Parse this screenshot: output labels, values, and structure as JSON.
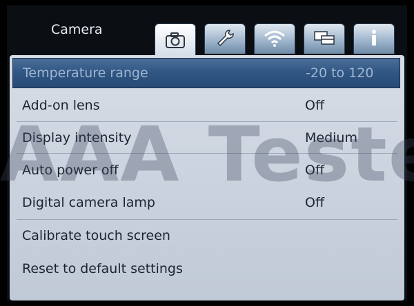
{
  "header": {
    "title": "Camera"
  },
  "tabs": [
    {
      "icon": "camera-icon",
      "active": true
    },
    {
      "icon": "wrench-icon",
      "active": false
    },
    {
      "icon": "wifi-icon",
      "active": false
    },
    {
      "icon": "devices-icon",
      "active": false
    },
    {
      "icon": "info-icon",
      "active": false
    }
  ],
  "settings": [
    {
      "label": "Temperature range",
      "value": "-20 to 120",
      "selected": true
    },
    {
      "label": "Add-on lens",
      "value": "Off"
    },
    {
      "label": "Display intensity",
      "value": "Medium"
    },
    {
      "label": "Auto power off",
      "value": "Off"
    },
    {
      "label": "Digital camera lamp",
      "value": "Off"
    },
    {
      "label": "Calibrate touch screen",
      "value": ""
    },
    {
      "label": "Reset to default settings",
      "value": ""
    }
  ],
  "watermark": "AAA Testers",
  "colors": {
    "selected_row": "#2f5582",
    "panel": "#cfd6e0",
    "background": "#0b0e13"
  }
}
